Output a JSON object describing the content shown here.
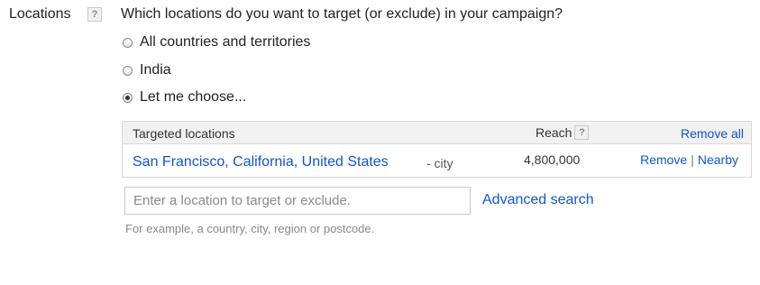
{
  "field": {
    "label": "Locations",
    "help_icon": "?",
    "question": "Which locations do you want to target (or exclude) in your campaign?"
  },
  "options": [
    {
      "label": "All countries and territories",
      "selected": false
    },
    {
      "label": "India",
      "selected": false
    },
    {
      "label": "Let me choose...",
      "selected": true
    }
  ],
  "targeted": {
    "header_locations": "Targeted locations",
    "header_reach": "Reach",
    "header_help": "?",
    "remove_all": "Remove all",
    "rows": [
      {
        "location": "San Francisco, California, United States",
        "type": "- city",
        "reach": "4,800,000",
        "remove": "Remove",
        "separator": "|",
        "nearby": "Nearby"
      }
    ]
  },
  "search": {
    "placeholder": "Enter a location to target or exclude.",
    "value": "",
    "advanced_search": "Advanced search",
    "hint": "For example, a country, city, region or postcode."
  },
  "colors": {
    "link": "#1155cc",
    "header_bg": "#f1f1f1",
    "hint": "#888888"
  }
}
